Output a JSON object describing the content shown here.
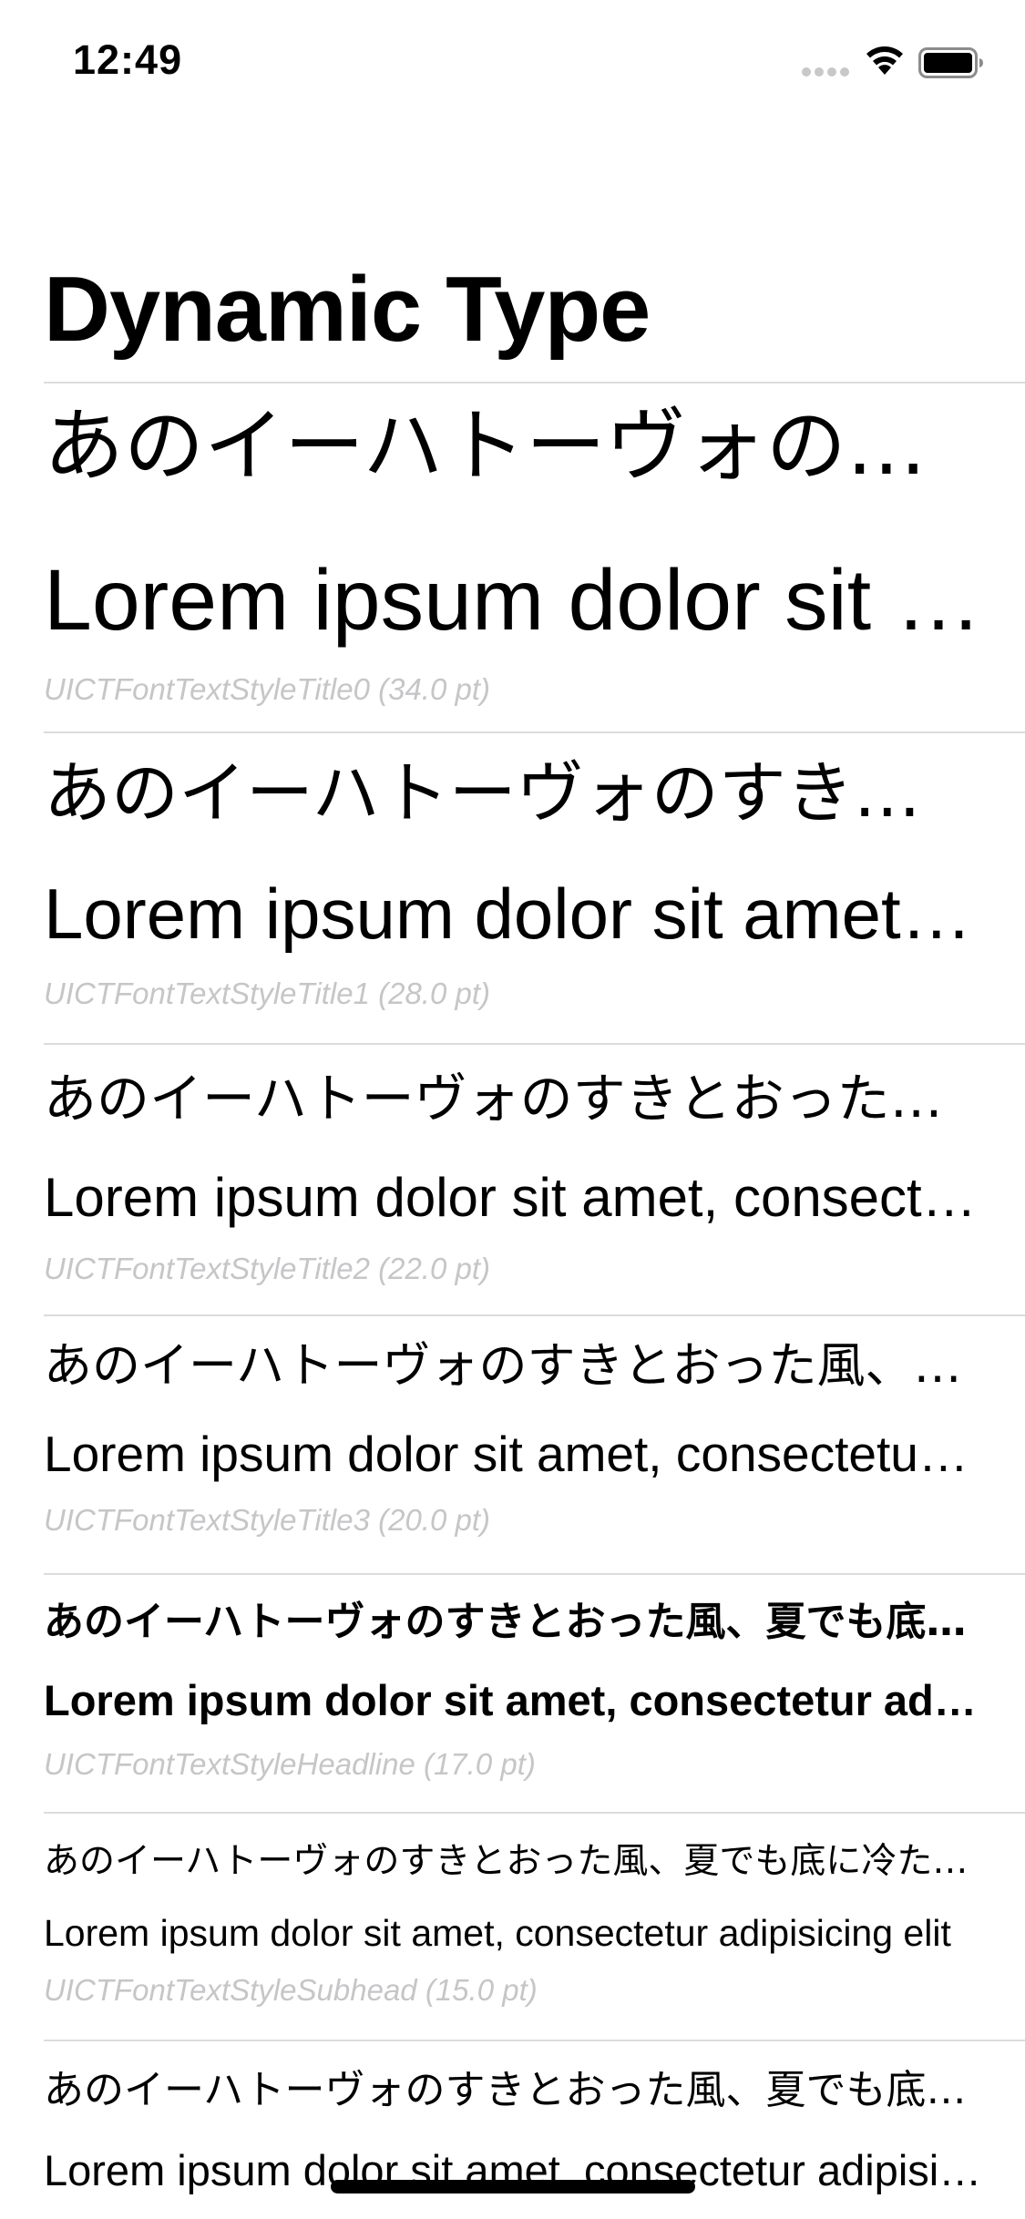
{
  "status_bar": {
    "time": "12:49",
    "signal_icon": "cellular-signal-icon",
    "wifi_icon": "wifi-icon",
    "battery_icon": "battery-icon"
  },
  "nav": {
    "title": "Dynamic Type"
  },
  "rows": [
    {
      "japanese": "あのイーハトーヴォのすきとおった風、夏でも底に冷たさをもつ青いそら",
      "latin": "Lorem ipsum dolor sit amet, consectetur adipisicing elit",
      "style_label": "UICTFontTextStyleTitle0 (34.0 pt)"
    },
    {
      "japanese": "あのイーハトーヴォのすきとおった風、夏でも底に冷たさをもつ青いそら",
      "latin": "Lorem ipsum dolor sit amet, consectetur adipisicing elit",
      "style_label": "UICTFontTextStyleTitle1 (28.0 pt)"
    },
    {
      "japanese": "あのイーハトーヴォのすきとおった風、夏でも底に冷たさをもつ青いそら",
      "latin": "Lorem ipsum dolor sit amet, consectetur adipisicing elit",
      "style_label": "UICTFontTextStyleTitle2 (22.0 pt)"
    },
    {
      "japanese": "あのイーハトーヴォのすきとおった風、夏でも底に冷たさをもつ青いそら",
      "latin": "Lorem ipsum dolor sit amet, consectetur adipisicing elit",
      "style_label": "UICTFontTextStyleTitle3 (20.0 pt)"
    },
    {
      "japanese": "あのイーハトーヴォのすきとおった風、夏でも底に冷たさをもつ青いそら",
      "latin": "Lorem ipsum dolor sit amet, consectetur adipisicing elit",
      "style_label": "UICTFontTextStyleHeadline (17.0 pt)"
    },
    {
      "japanese": "あのイーハトーヴォのすきとおった風、夏でも底に冷たさをもつ青いそら",
      "latin": "Lorem ipsum dolor sit amet, consectetur adipisicing elit",
      "style_label": "UICTFontTextStyleSubhead (15.0 pt)"
    },
    {
      "japanese": "あのイーハトーヴォのすきとおった風、夏でも底に冷たさをもつ青いそら",
      "latin": "Lorem ipsum dolor sit amet, consectetur adipisicing elit"
    }
  ],
  "colors": {
    "text": "#000000",
    "secondary_label": "#c6c6c8",
    "separator": "#dcdcdc",
    "background": "#ffffff"
  }
}
